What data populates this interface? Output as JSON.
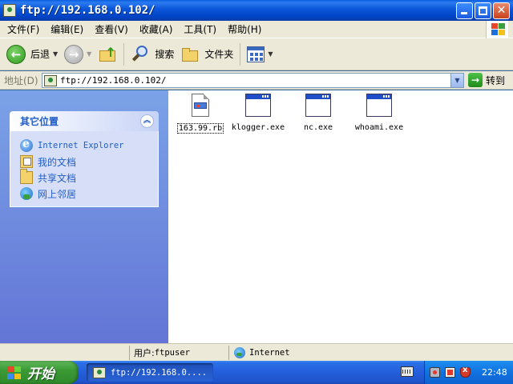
{
  "window": {
    "title": "ftp://192.168.0.102/"
  },
  "menubar": {
    "items": [
      "文件(F)",
      "编辑(E)",
      "查看(V)",
      "收藏(A)",
      "工具(T)",
      "帮助(H)"
    ]
  },
  "toolbar": {
    "back_label": "后退",
    "search_label": "搜索",
    "folders_label": "文件夹"
  },
  "address": {
    "label": "地址(D)",
    "value": "ftp://192.168.0.102/",
    "go_label": "转到"
  },
  "sidebar": {
    "panel_title": "其它位置",
    "places": [
      {
        "label": "Internet Explorer",
        "icon": "ie-icon"
      },
      {
        "label": "我的文档",
        "icon": "my-documents-icon"
      },
      {
        "label": "共享文档",
        "icon": "shared-documents-icon"
      },
      {
        "label": "网上邻居",
        "icon": "network-places-icon"
      }
    ]
  },
  "files": [
    {
      "name": "163.99.rb",
      "icon": "ruby-file-icon",
      "selected": true
    },
    {
      "name": "klogger.exe",
      "icon": "exe-icon",
      "selected": false
    },
    {
      "name": "nc.exe",
      "icon": "exe-icon",
      "selected": false
    },
    {
      "name": "whoami.exe",
      "icon": "exe-icon",
      "selected": false
    }
  ],
  "statusbar": {
    "user_label": "用户: ",
    "user_value": "ftpuser",
    "zone": "Internet"
  },
  "taskbar": {
    "start_label": "开始",
    "task_label": "ftp://192.168.0....",
    "clock": "22:48"
  }
}
